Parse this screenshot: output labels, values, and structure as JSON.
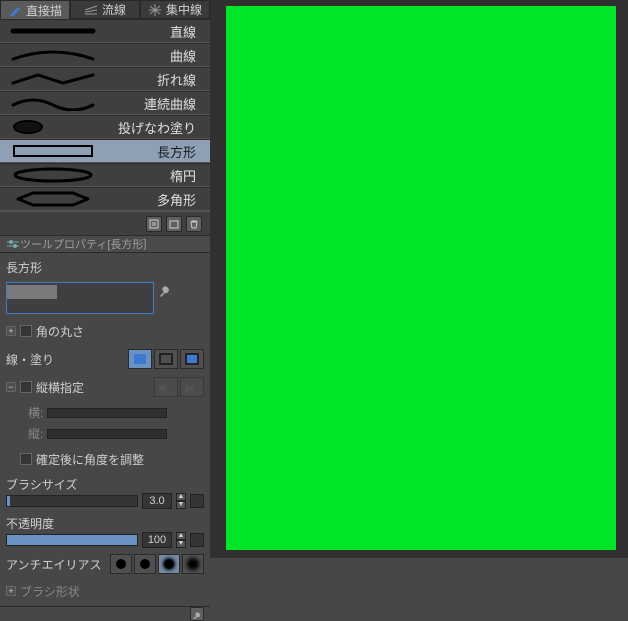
{
  "tabs": {
    "direct": "直接描",
    "flow": "流線",
    "concentrate": "集中線"
  },
  "subtools": [
    {
      "label": "直線"
    },
    {
      "label": "曲線"
    },
    {
      "label": "折れ線"
    },
    {
      "label": "連続曲線"
    },
    {
      "label": "投げなわ塗り"
    },
    {
      "label": "長方形"
    },
    {
      "label": "楕円"
    },
    {
      "label": "多角形"
    }
  ],
  "prop": {
    "header_prefix": "ツールプロパティ[",
    "header_suffix": "]",
    "tool_name": "長方形",
    "preview_label": "長方形",
    "round_corner": "角の丸さ",
    "line_fill": "線・塗り",
    "aspect": "縦横指定",
    "aspect_h": "横:",
    "aspect_v": "縦:",
    "angle_after": "確定後に角度を調整",
    "brush_size": "ブラシサイズ",
    "brush_size_val": "3.0",
    "opacity": "不透明度",
    "opacity_val": "100",
    "antialias": "アンチエイリアス",
    "brush_shape": "ブラシ形状"
  }
}
